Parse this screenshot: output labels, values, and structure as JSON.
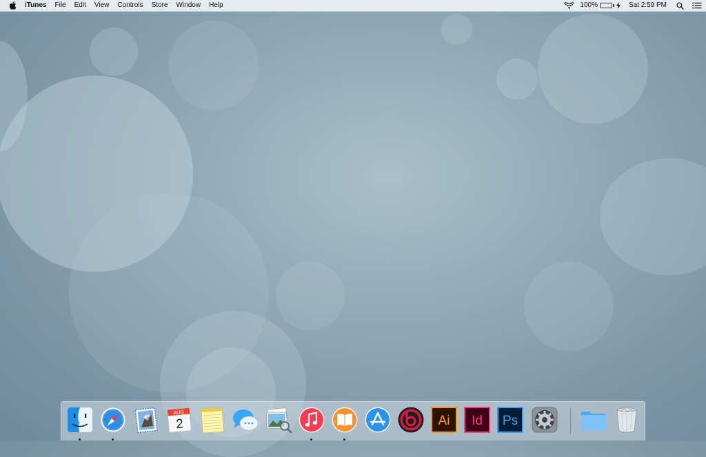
{
  "menubar": {
    "apple_icon": "apple-logo-icon",
    "app_name": "iTunes",
    "menus": [
      "File",
      "Edit",
      "View",
      "Controls",
      "Store",
      "Window",
      "Help"
    ],
    "status": {
      "wifi_icon": "wifi-icon",
      "battery_percent": "100%",
      "battery_level": 1.0,
      "charging_icon": "charging-bolt-icon",
      "clock": "Sat 2:59 PM",
      "spotlight_icon": "spotlight-search-icon",
      "notification_icon": "notification-center-icon"
    }
  },
  "dock": {
    "apps": [
      {
        "name": "Finder",
        "icon": "finder-icon",
        "running": true
      },
      {
        "name": "Safari",
        "icon": "safari-icon",
        "running": true
      },
      {
        "name": "Mail",
        "icon": "mail-icon",
        "running": false
      },
      {
        "name": "Calendar",
        "icon": "calendar-icon",
        "running": false,
        "month": "AUG",
        "day": "2"
      },
      {
        "name": "Notes",
        "icon": "notes-icon",
        "running": false
      },
      {
        "name": "Messages",
        "icon": "messages-icon",
        "running": false
      },
      {
        "name": "Preview",
        "icon": "preview-icon",
        "running": false
      },
      {
        "name": "iTunes",
        "icon": "itunes-icon",
        "running": true
      },
      {
        "name": "iBooks",
        "icon": "ibooks-icon",
        "running": true
      },
      {
        "name": "App Store",
        "icon": "app-store-icon",
        "running": false
      },
      {
        "name": "Beats",
        "icon": "beats-icon",
        "running": false
      },
      {
        "name": "Adobe Illustrator",
        "icon": "illustrator-icon",
        "running": false,
        "label": "Ai"
      },
      {
        "name": "Adobe InDesign",
        "icon": "indesign-icon",
        "running": false,
        "label": "Id"
      },
      {
        "name": "Adobe Photoshop",
        "icon": "photoshop-icon",
        "running": false,
        "label": "Ps"
      },
      {
        "name": "System Preferences",
        "icon": "system-preferences-icon",
        "running": false
      }
    ],
    "stacks": [
      {
        "name": "Folder",
        "icon": "folder-icon"
      },
      {
        "name": "Trash",
        "icon": "trash-icon"
      }
    ]
  },
  "colors": {
    "wallpaper": "#8ea8b7",
    "battery_fill": "#30c03a",
    "illustrator": "#ff9a00",
    "indesign": "#ff3c7e",
    "photoshop": "#31a8ff"
  }
}
